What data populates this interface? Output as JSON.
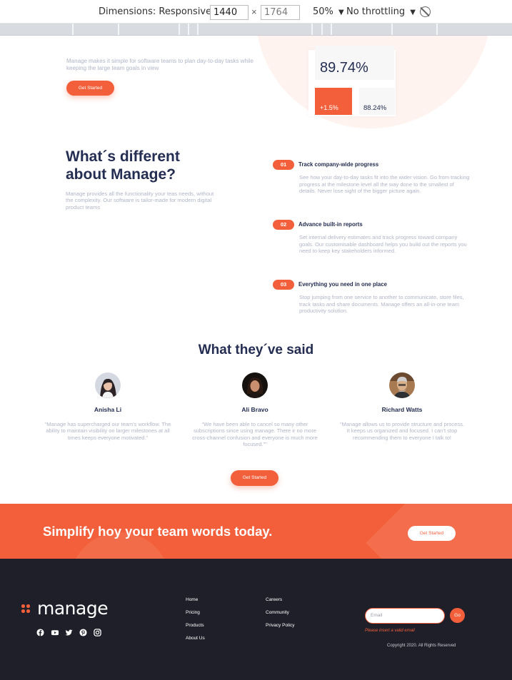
{
  "devtools": {
    "dimensions_label": "Dimensions: Responsive",
    "width": "1440",
    "height": "1764",
    "x_symbol": "×",
    "zoom": "50%",
    "throttling": "No throttling"
  },
  "intro": {
    "text": "Manage makes it simple for software teams to plan day-to-day tasks while keeping the large team goals in view",
    "cta": "Get Started"
  },
  "stats": {
    "big_value": "89.74%",
    "change": "+1.5%",
    "secondary": "88.24%"
  },
  "different": {
    "title": "What´s different about Manage?",
    "text": "Manage provides all the functionality your teas needs, without the complexity. Our software is tailor-made for modern digital product teams"
  },
  "features": [
    {
      "number": "01",
      "title": "Track company-wide progress",
      "desc": "See how your day-to-day tasks fit into the wider vision. Go from tracking progress at the milestone level all the way done to the smallest of details. Never lose sight of the bigger picture again."
    },
    {
      "number": "02",
      "title": "Advance built-in reports",
      "desc": "Set internal delivery estimates and track progress toward company goals. Our customisable dashboard helps you build out the reports you need to keep key stakeholders informed."
    },
    {
      "number": "03",
      "title": "Everything you need in one place",
      "desc": "Stop jumping from one service to another to communicate, store files, track tasks and share documents. Manage offers an all-in-one team productivity solution."
    }
  ],
  "testimonials": {
    "title": "What they´ve said",
    "items": [
      {
        "name": "Anisha Li",
        "quote": "“Manage has supercharged our team’s workflow. The ability to maintain visibility on larger milestones at all times keeps everyone motivated.”"
      },
      {
        "name": "Ali Bravo",
        "quote": "“We have been able to cancel so many other subscriptions since using manage. There ir no more cross-channel confusion and everyone is much more focused.”\""
      },
      {
        "name": "Richard Watts",
        "quote": "“Manage allows us to provide structure and process. It keeps us organized and focused. I can’t stop recommending them to everyone I talk to!"
      }
    ],
    "cta": "Get Started"
  },
  "cta_band": {
    "text": "Simplify hoy your team words today.",
    "button": "Get Started"
  },
  "footer": {
    "logo": "manage",
    "links_col1": [
      "Home",
      "Pricing",
      "Products",
      "About Us"
    ],
    "links_col2": [
      "Careers",
      "Community",
      "Privacy Policy"
    ],
    "email_placeholder": "Email",
    "go": "Go",
    "error": "Please insert a valid email",
    "copyright": "Copyright 2020. All Rights Reserved",
    "social": [
      "facebook-icon",
      "youtube-icon",
      "twitter-icon",
      "pinterest-icon",
      "instagram-icon"
    ]
  },
  "colors": {
    "brand_orange": "#f25f3a",
    "navy": "#242d52",
    "footer_bg": "#1f1f2a",
    "muted_text": "#b1b5c8"
  }
}
